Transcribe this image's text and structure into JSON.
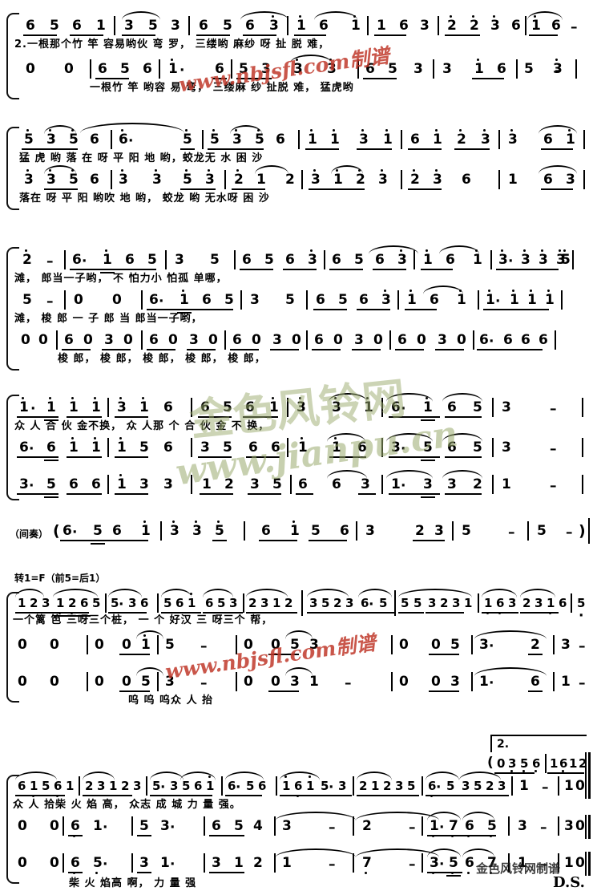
{
  "document": {
    "kind": "jianpu-choral-score",
    "key_change_note": "转1=F（前5=后1）",
    "interlude_label": "（间奏）",
    "ds_marking": "D.S."
  },
  "watermarks": {
    "red_text": "www.nbjsfl.com制谱",
    "green_text": "www.jianpu.cn",
    "green_cn": "金色风铃网",
    "bottom_text": "金色风铃网制谱"
  },
  "endings": {
    "second": "2."
  },
  "systems": [
    {
      "id": "system-1",
      "voices": [
        {
          "id": "s1-v1",
          "notes": "6 5 6 1 | 3 5 3 | 6 5 6 3 | 1 6  1 | 1 6 3 | 2 2 3 6 | 1 6 5 6 | 3 - | 0   0 |",
          "lyric": "2.一根那个竹  竿  容易哟伙 弯 罗，        三缕哟    麻纱  呀  扯  脱    难，"
        },
        {
          "id": "s1-v2",
          "notes": "0   0 | 6 5 6 | 1·   6 | 5 3  3· 3 | 6 5 3 | 3  1 6 | 5 - | 3 3 5 |",
          "lyric": "一根竹  竿    哟容 易 弯，      三缕麻   纱        扯脱  难，    猛虎哟"
        }
      ]
    },
    {
      "id": "system-2",
      "voices": [
        {
          "id": "s2-v1",
          "notes": "5 3 5 6 | 6·      5 | 5 3 5 6 | 1 1  3 1 | 6 1 2 3 | 3 | 6 1 |",
          "lyric": "猛 虎  哟         落 在  呀   平 阳   地  哟，蛟龙无 水  困   沙"
        },
        {
          "id": "s2-v2",
          "notes": "3 3 5 6 | 3 3 5 3 | 2 1  2 | 3 1 2 3 | 2 3 6 | 1 | 6 3 |",
          "lyric": "落在  呀   平 阳 哟吹  地 哟，      蛟龙  哟    无水呀     困  沙"
        }
      ]
    },
    {
      "id": "system-3",
      "voices": [
        {
          "id": "s3-v1",
          "notes": "2 - | 6· 1 6 5 | 3     5 | 6 5 6 3 | 6 5 6 3 | 1 6  1 | 3· 3 3 3 | 5 3 5 3 6 |",
          "lyric": "滩，                                  郎当一子哟，          不 怕力小 怕孤 单哪，"
        },
        {
          "id": "s3-v2",
          "notes": "5 - | 0     0 | 6· 1 6 5 | 3    5 | 6 5 6 3 | 1 6  1 | 1· 1 1 1 | 3 1 3 1 6 |",
          "lyric": "滩，            梭 郎 一 子 郎  当    郎当一子哟，"
        },
        {
          "id": "s3-v3",
          "notes": "0 0 | 6 0 3 0 | 6 0 3 0 | 6 0 3 0 | 6 0 3 0 | 6 0 3 0 | 6· 6 6 6 | 1 6 5 6 3 |",
          "lyric": "梭  郎，  梭  郎，  梭  郎，  梭  郎，  梭  郎，"
        }
      ]
    },
    {
      "id": "system-4",
      "voices": [
        {
          "id": "s4-v1",
          "notes": "1· 1  1 1 | 3 1 6 | 6 5 6 1 | 3  3 1 | 6· 1 6 5 | 3    - |",
          "lyric": "众 人  合 伙 金不换，  众 人那 个 合  伙    金    不    换，"
        },
        {
          "id": "s4-v2",
          "notes": "6· 6  1 1 | 1 5 6 | 3 5 6 6 | 1  1 6 | 3· 5 6 5 | 3    - |",
          "lyric": ""
        },
        {
          "id": "s4-v3",
          "notes": "3· 5  6 6 | 1 3 3 | 1 2 3 5 | 6 6 3 | 1· 3 3 2 | 1    - |",
          "lyric": ""
        }
      ]
    },
    {
      "id": "system-5",
      "voices": [
        {
          "id": "s5-v1",
          "notes": "（间奏）(6· 5 6 1 | 3 3 5 |  6 1 5 6 | 3   2 3 | 5    -  | 5   - )",
          "lyric": ""
        }
      ]
    },
    {
      "id": "system-6",
      "voices": [
        {
          "id": "s6-v1",
          "notes": "1 2 3 1 2 6 5 | 5·3 5 | 5 6 1 6 5 3 | 2 3 1 2 | 3 5 2 3 6· 5 | 5 5 3 2 3 1 | 1 6 3 2 3 1 6 | 5  - |",
          "lyric": "一个篱  笆   三呀三个桩，  一  个  好汉   三 呀三个 帮，"
        },
        {
          "id": "s6-v2",
          "notes": "0   0 | 0  0 1 | 5   - | 0   0 5 | 3   - | 0  0 5 | 3·    2 | 3 - |",
          "lyric": ""
        },
        {
          "id": "s6-v3",
          "notes": "0   0 | 0  0 5 | 3   - | 0  0 3 | 1   - | 0  0 3 | 1·    6 | 1 - |",
          "lyric": "呜         呜          呜众    人  抬"
        }
      ]
    },
    {
      "id": "system-7",
      "voices": [
        {
          "id": "s7-v1",
          "notes": "6 1 5 6 1 | 2 3 1 2 3 | 5· 3 5 6 1 | 6· 5 6 | 1 6 1 5· 3 | 2 1 2 3 5 | 6· 5 3 5 2 3 | 1 - | 1 0 :|",
          "lyric": "众    人 拾柴   火 焰  高，   众志    成   城 力  量    强。"
        },
        {
          "id": "s7-v2",
          "notes": "0   0 | 6 1· | 5 3· | 6 5 4 | 3  -  | 2  - | 1· 7 6 5 | 3 - | 3 0 :|",
          "lyric": ""
        },
        {
          "id": "s7-v3",
          "notes": "0   0 | 6 5· | 3 1· | 3 1 2 | 1  -  | 7  - | 3· 5 6 7 | 1 - | 1 0 :|",
          "lyric": "柴 火   焰高   啊，        力        量   强"
        }
      ],
      "second_ending": {
        "label": "2.",
        "notes": "(0 3 5 6 | 1 6 1 2 :|"
      }
    }
  ]
}
